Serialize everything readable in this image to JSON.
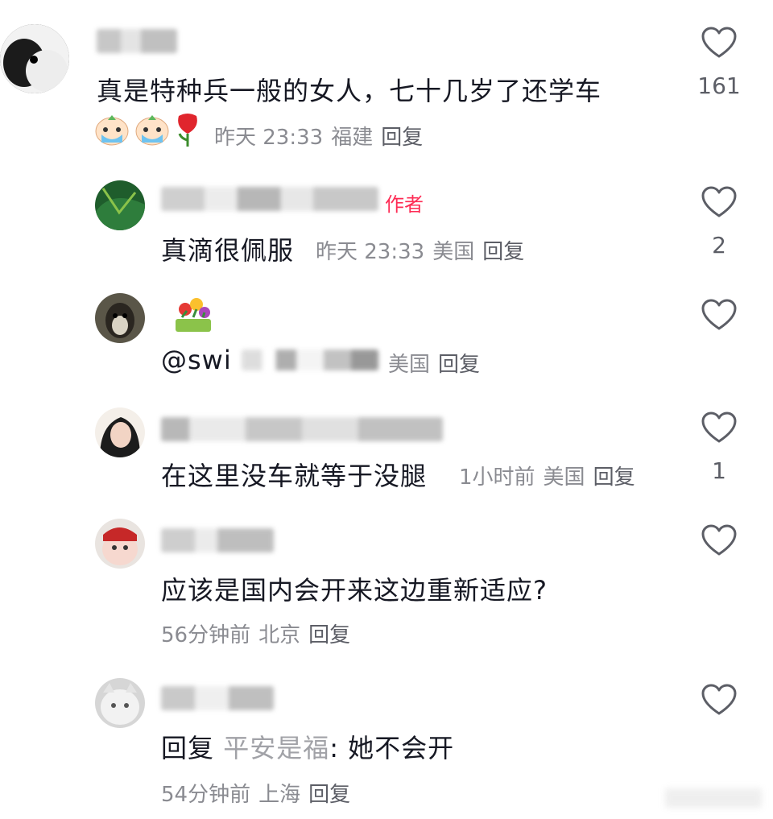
{
  "comments": [
    {
      "text": "真是特种兵一般的女人，七十几岁了还学车",
      "time": "昨天 23:33",
      "location": "福建",
      "reply_label": "回复",
      "likes": "161",
      "emojis": [
        "crying-face-emoji",
        "crying-face-emoji",
        "rose-emoji"
      ]
    },
    {
      "author_tag": "作者",
      "text": "真滴很佩服",
      "time": "昨天 23:33",
      "location": "美国",
      "reply_label": "回复",
      "likes": "2"
    },
    {
      "text": "@swi",
      "location": "美国",
      "reply_label": "回复",
      "likes": "",
      "emojis": [
        "flower-bouquet-emoji"
      ]
    },
    {
      "text": "在这里没车就等于没腿",
      "time": "1小时前",
      "location": "美国",
      "reply_label": "回复",
      "likes": "1"
    },
    {
      "text": "应该是国内会开来这边重新适应?",
      "time": "56分钟前",
      "location": "北京",
      "reply_label": "回复",
      "likes": ""
    },
    {
      "text_prefix": "回复",
      "quoted_user": "平安是福",
      "text": ": 她不会开",
      "time": "54分钟前",
      "location": "上海",
      "reply_label": "回复",
      "likes": ""
    }
  ],
  "colors": {
    "primary_text": "#161823",
    "secondary_text": "#8a8b91",
    "author_tag": "#fe2c55",
    "heart_outline": "#5c5e66"
  },
  "icons": {
    "like": "heart-outline-icon"
  }
}
